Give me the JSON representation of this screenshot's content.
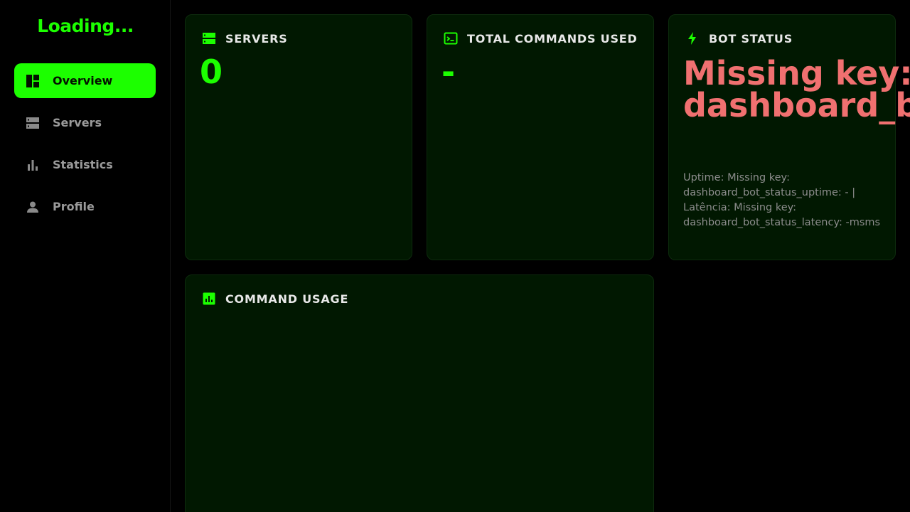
{
  "sidebar": {
    "brand": "Loading...",
    "items": [
      {
        "label": "Overview",
        "icon": "dashboard-icon",
        "active": true
      },
      {
        "label": "Servers",
        "icon": "server-icon",
        "active": false
      },
      {
        "label": "Statistics",
        "icon": "bar-chart-icon",
        "active": false
      },
      {
        "label": "Profile",
        "icon": "person-icon",
        "active": false
      }
    ]
  },
  "cards": {
    "servers": {
      "title": "SERVERS",
      "value": "0",
      "icon": "server-icon"
    },
    "commands": {
      "title": "TOTAL COMMANDS USED",
      "value": "-",
      "icon": "terminal-icon"
    },
    "bot_status": {
      "title": "BOT STATUS",
      "icon": "bolt-icon",
      "status": "Missing key: dashboard_b",
      "details": "Uptime: Missing key: dashboard_bot_status_uptime: - | Latência: Missing key: dashboard_bot_status_latency: -msms"
    },
    "command_usage": {
      "title": "COMMAND USAGE",
      "icon": "chart-icon"
    }
  },
  "colors": {
    "accent": "#1cff00",
    "card_bg": "#011801",
    "error": "#f07070",
    "background": "#000000"
  }
}
